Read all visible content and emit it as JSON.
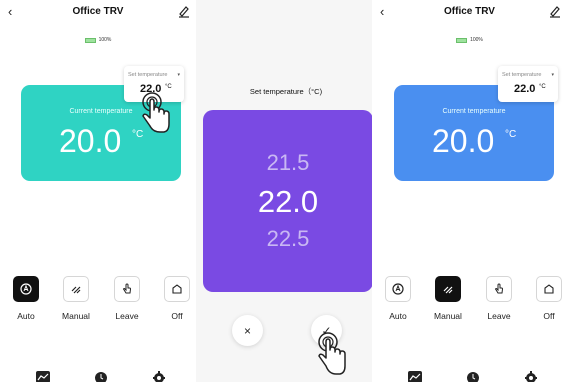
{
  "left": {
    "title": "Office TRV",
    "back_icon": "‹",
    "battery": "100%",
    "setpoint_label": "Set temperature",
    "setpoint_caret": "▾",
    "setpoint_value": "22.0",
    "setpoint_unit": "°C",
    "card_label": "Current temperature",
    "card_value": "20.0",
    "card_unit": "°C",
    "card_color": "#2fd3c3",
    "modes": [
      {
        "label": "Auto",
        "icon": "auto-icon",
        "active": true
      },
      {
        "label": "Manual",
        "icon": "manual-icon",
        "active": false
      },
      {
        "label": "Leave",
        "icon": "leave-icon",
        "active": false
      },
      {
        "label": "Off",
        "icon": "off-icon",
        "active": false
      }
    ]
  },
  "middle": {
    "picker_title": "Set temperature（°C)",
    "options": [
      "21.5",
      "22.0",
      "22.5"
    ],
    "selected": "22.0",
    "picker_color": "#7a4ae3",
    "cancel_icon": "×",
    "confirm_icon": "✓"
  },
  "right": {
    "title": "Office TRV",
    "back_icon": "‹",
    "battery": "100%",
    "setpoint_label": "Set temperature",
    "setpoint_caret": "▾",
    "setpoint_value": "22.0",
    "setpoint_unit": "°C",
    "card_label": "Current temperature",
    "card_value": "20.0",
    "card_unit": "°C",
    "card_color": "#4a8ff0",
    "modes": [
      {
        "label": "Auto",
        "icon": "auto-icon",
        "active": false
      },
      {
        "label": "Manual",
        "icon": "manual-icon",
        "active": true
      },
      {
        "label": "Leave",
        "icon": "leave-icon",
        "active": false
      },
      {
        "label": "Off",
        "icon": "off-icon",
        "active": false
      }
    ]
  }
}
